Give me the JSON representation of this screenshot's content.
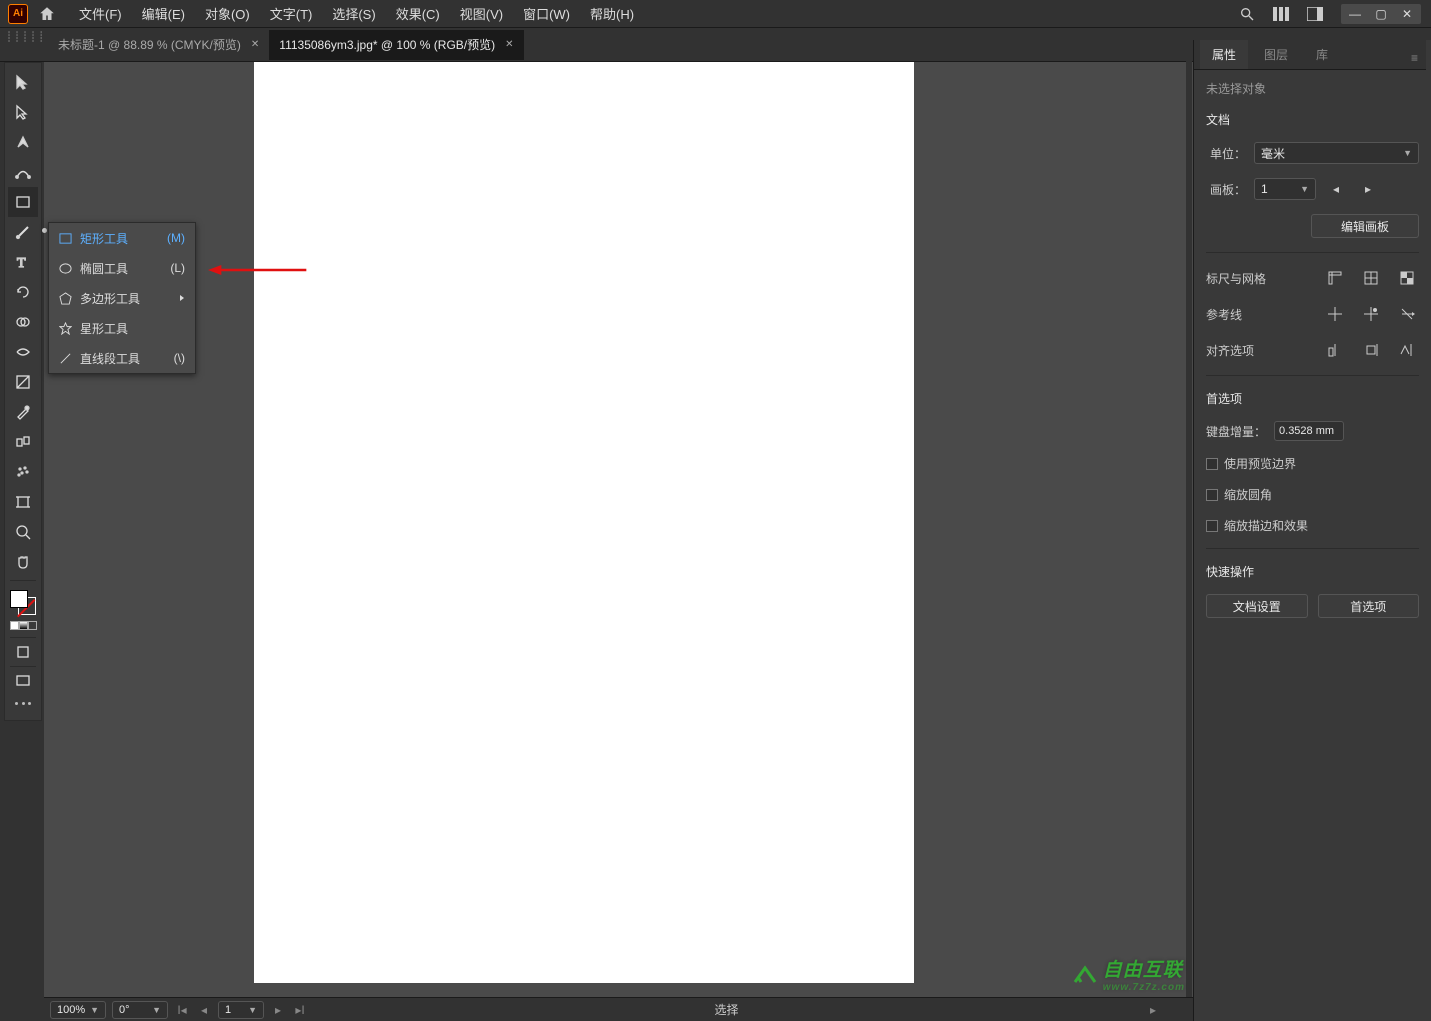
{
  "app": {
    "logo_text": "Ai"
  },
  "menu": {
    "file": "文件(F)",
    "edit": "编辑(E)",
    "object": "对象(O)",
    "type": "文字(T)",
    "select": "选择(S)",
    "effect": "效果(C)",
    "view": "视图(V)",
    "window": "窗口(W)",
    "help": "帮助(H)"
  },
  "window_controls": {
    "min": "—",
    "max": "▢",
    "close": "✕"
  },
  "tabs": [
    {
      "label": "未标题-1 @ 88.89 % (CMYK/预览)",
      "active": false
    },
    {
      "label": "11135086ym3.jpg* @ 100 % (RGB/预览)",
      "active": true
    }
  ],
  "flyout": {
    "items": [
      {
        "label": "矩形工具",
        "shortcut": "(M)",
        "selected": true
      },
      {
        "label": "椭圆工具",
        "shortcut": "(L)",
        "selected": false
      },
      {
        "label": "多边形工具",
        "shortcut": "",
        "selected": false,
        "submenu": true
      },
      {
        "label": "星形工具",
        "shortcut": "",
        "selected": false
      },
      {
        "label": "直线段工具",
        "shortcut": "(\\)",
        "selected": false
      }
    ]
  },
  "rp": {
    "tabs": {
      "properties": "属性",
      "layers": "图层",
      "libraries": "库"
    },
    "no_selection": "未选择对象",
    "section_doc": "文档",
    "unit_label": "单位：",
    "unit_value": "毫米",
    "artboard_label": "画板：",
    "artboard_value": "1",
    "edit_artboard": "编辑画板",
    "section_rulers": "标尺与网格",
    "section_guides": "参考线",
    "section_align": "对齐选项",
    "section_prefs": "首选项",
    "key_increment_label": "键盘增量：",
    "key_increment_value": "0.3528 mm",
    "use_preview_bounds": "使用预览边界",
    "scale_corners": "缩放圆角",
    "scale_strokes": "缩放描边和效果",
    "section_quick": "快速操作",
    "doc_setup_btn": "文档设置",
    "prefs_btn": "首选项"
  },
  "status": {
    "zoom": "100%",
    "rotate": "0°",
    "artboard_num": "1",
    "mode": "选择"
  },
  "watermark_main": "自由互联",
  "watermark_sub": "www.7z7z.com"
}
